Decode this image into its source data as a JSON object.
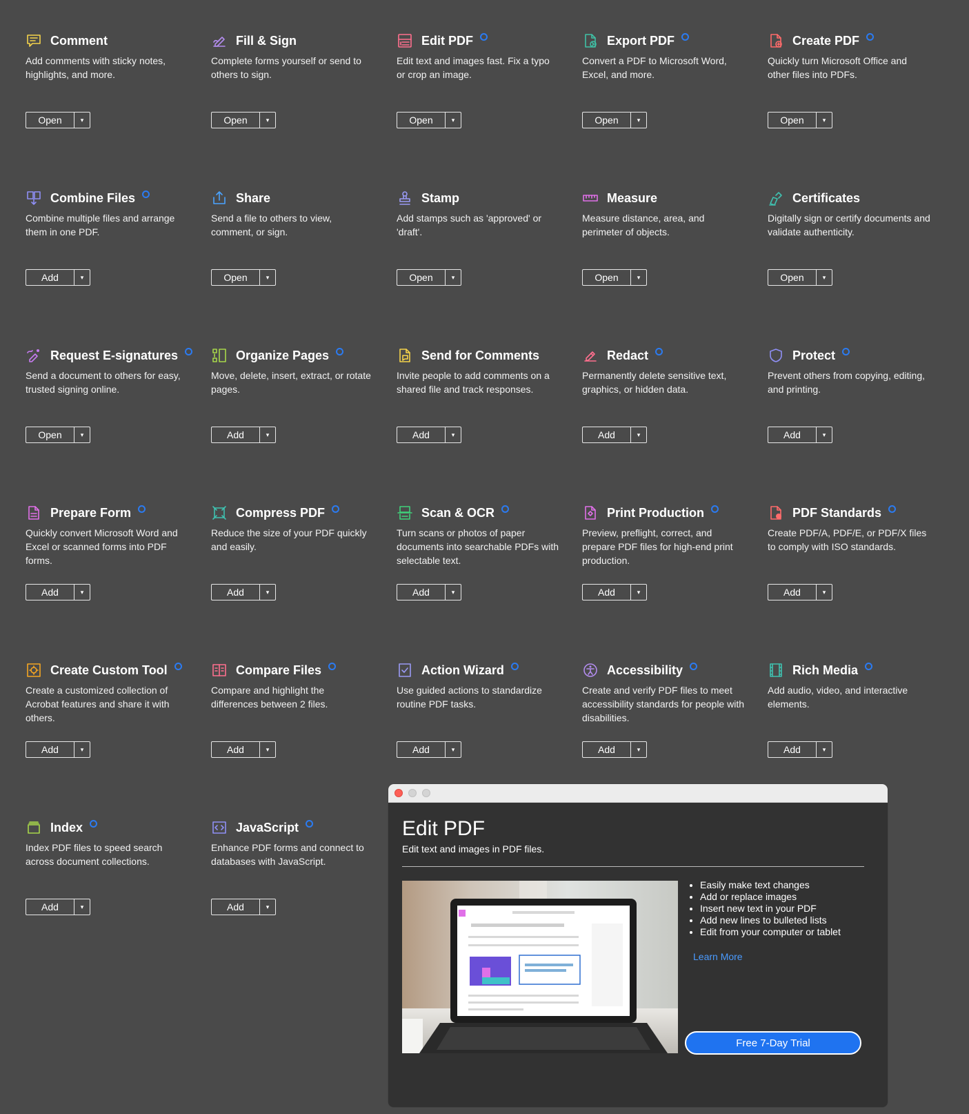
{
  "tools": [
    {
      "id": "comment",
      "title": "Comment",
      "desc": "Add comments with sticky notes, highlights, and more.",
      "button": "Open",
      "premium": false,
      "icon": "comment-icon",
      "color": "#f5d34b"
    },
    {
      "id": "fill-sign",
      "title": "Fill & Sign",
      "desc": "Complete forms yourself or send to others to sign.",
      "button": "Open",
      "premium": false,
      "icon": "fill-sign-icon",
      "color": "#b48df0"
    },
    {
      "id": "edit-pdf",
      "title": "Edit PDF",
      "desc": "Edit text and images fast. Fix a typo or crop an image.",
      "button": "Open",
      "premium": true,
      "icon": "edit-pdf-icon",
      "color": "#ff6f8e"
    },
    {
      "id": "export-pdf",
      "title": "Export PDF",
      "desc": "Convert a PDF to Microsoft Word, Excel, and more.",
      "button": "Open",
      "premium": true,
      "icon": "export-pdf-icon",
      "color": "#3fc1a6"
    },
    {
      "id": "create-pdf",
      "title": "Create PDF",
      "desc": "Quickly turn Microsoft Office and other files into PDFs.",
      "button": "Open",
      "premium": true,
      "icon": "create-pdf-icon",
      "color": "#ff6b6b"
    },
    {
      "id": "combine-files",
      "title": "Combine Files",
      "desc": "Combine multiple files and arrange them in one PDF.",
      "button": "Add",
      "premium": true,
      "icon": "combine-files-icon",
      "color": "#8f8ff5"
    },
    {
      "id": "share",
      "title": "Share",
      "desc": "Send a file to others to view, comment, or sign.",
      "button": "Open",
      "premium": false,
      "icon": "share-icon",
      "color": "#4aa3ff"
    },
    {
      "id": "stamp",
      "title": "Stamp",
      "desc": "Add stamps such as 'approved' or 'draft'.",
      "button": "Open",
      "premium": false,
      "icon": "stamp-icon",
      "color": "#9a9af5"
    },
    {
      "id": "measure",
      "title": "Measure",
      "desc": "Measure distance, area, and perimeter of objects.",
      "button": "Open",
      "premium": false,
      "icon": "measure-icon",
      "color": "#e070e8"
    },
    {
      "id": "certificates",
      "title": "Certificates",
      "desc": "Digitally sign or certify documents and validate authenticity.",
      "button": "Open",
      "premium": false,
      "icon": "certificates-icon",
      "color": "#3fc1b0"
    },
    {
      "id": "request-esignatures",
      "title": "Request E-signatures",
      "desc": "Send a document to others for easy, trusted signing online.",
      "button": "Open",
      "premium": true,
      "icon": "request-esignatures-icon",
      "color": "#c77bf2"
    },
    {
      "id": "organize-pages",
      "title": "Organize Pages",
      "desc": "Move, delete, insert, extract, or rotate pages.",
      "button": "Add",
      "premium": true,
      "icon": "organize-pages-icon",
      "color": "#a8d84a"
    },
    {
      "id": "send-for-comments",
      "title": "Send for Comments",
      "desc": "Invite people to add comments on a shared file and track responses.",
      "button": "Add",
      "premium": false,
      "icon": "send-for-comments-icon",
      "color": "#f5d34b"
    },
    {
      "id": "redact",
      "title": "Redact",
      "desc": "Permanently delete sensitive text, graphics, or hidden data.",
      "button": "Add",
      "premium": true,
      "icon": "redact-icon",
      "color": "#ff6f8e"
    },
    {
      "id": "protect",
      "title": "Protect",
      "desc": "Prevent others from copying, editing, and printing.",
      "button": "Add",
      "premium": true,
      "icon": "protect-icon",
      "color": "#8f8ff5"
    },
    {
      "id": "prepare-form",
      "title": "Prepare Form",
      "desc": "Quickly convert Microsoft Word and Excel or scanned forms into PDF forms.",
      "button": "Add",
      "premium": true,
      "icon": "prepare-form-icon",
      "color": "#e070e8"
    },
    {
      "id": "compress-pdf",
      "title": "Compress PDF",
      "desc": "Reduce the size of your PDF quickly and easily.",
      "button": "Add",
      "premium": true,
      "icon": "compress-pdf-icon",
      "color": "#3fc1b0"
    },
    {
      "id": "scan-ocr",
      "title": "Scan & OCR",
      "desc": "Turn scans or photos of paper documents into searchable PDFs with selectable text.",
      "button": "Add",
      "premium": true,
      "icon": "scan-ocr-icon",
      "color": "#3fd17a"
    },
    {
      "id": "print-production",
      "title": "Print Production",
      "desc": "Preview, preflight, correct, and prepare PDF files for high-end print production.",
      "button": "Add",
      "premium": true,
      "icon": "print-production-icon",
      "color": "#e070e8"
    },
    {
      "id": "pdf-standards",
      "title": "PDF Standards",
      "desc": "Create PDF/A, PDF/E, or PDF/X files to comply with ISO standards.",
      "button": "Add",
      "premium": true,
      "icon": "pdf-standards-icon",
      "color": "#ff6b6b"
    },
    {
      "id": "create-custom-tool",
      "title": "Create Custom Tool",
      "desc": "Create a customized collection of Acrobat features and share it with others.",
      "button": "Add",
      "premium": true,
      "icon": "create-custom-tool-icon",
      "color": "#f5a623"
    },
    {
      "id": "compare-files",
      "title": "Compare Files",
      "desc": "Compare and highlight the differences between 2 files.",
      "button": "Add",
      "premium": true,
      "icon": "compare-files-icon",
      "color": "#ff6f8e"
    },
    {
      "id": "action-wizard",
      "title": "Action Wizard",
      "desc": "Use guided actions to standardize routine PDF tasks.",
      "button": "Add",
      "premium": true,
      "icon": "action-wizard-icon",
      "color": "#9a9af5"
    },
    {
      "id": "accessibility",
      "title": "Accessibility",
      "desc": "Create and verify PDF files to meet accessibility standards for people with disabilities.",
      "button": "Add",
      "premium": true,
      "icon": "accessibility-icon",
      "color": "#b48df0"
    },
    {
      "id": "rich-media",
      "title": "Rich Media",
      "desc": "Add audio, video, and interactive elements.",
      "button": "Add",
      "premium": true,
      "icon": "rich-media-icon",
      "color": "#3fc1b0"
    },
    {
      "id": "index",
      "title": "Index",
      "desc": "Index PDF files to speed search across document collections.",
      "button": "Add",
      "premium": true,
      "icon": "index-icon",
      "color": "#a8d84a"
    },
    {
      "id": "javascript",
      "title": "JavaScript",
      "desc": "Enhance PDF forms and connect to databases with JavaScript.",
      "button": "Add",
      "premium": true,
      "icon": "javascript-icon",
      "color": "#8f8ff5"
    }
  ],
  "dropdown_glyph": "▾",
  "popup": {
    "title": "Edit PDF",
    "subtitle": "Edit text and images in PDF files.",
    "bullets": [
      "Easily make text changes",
      "Add or replace images",
      "Insert new text in your PDF",
      "Add new lines to bulleted lists",
      "Edit from your computer or tablet"
    ],
    "learn_more": "Learn More",
    "trial_button": "Free 7-Day Trial"
  },
  "colors": {
    "background": "#4a4a4a",
    "premium_dot": "#2b7bf2",
    "trial_button": "#1f73f0",
    "link": "#4a9bff"
  }
}
